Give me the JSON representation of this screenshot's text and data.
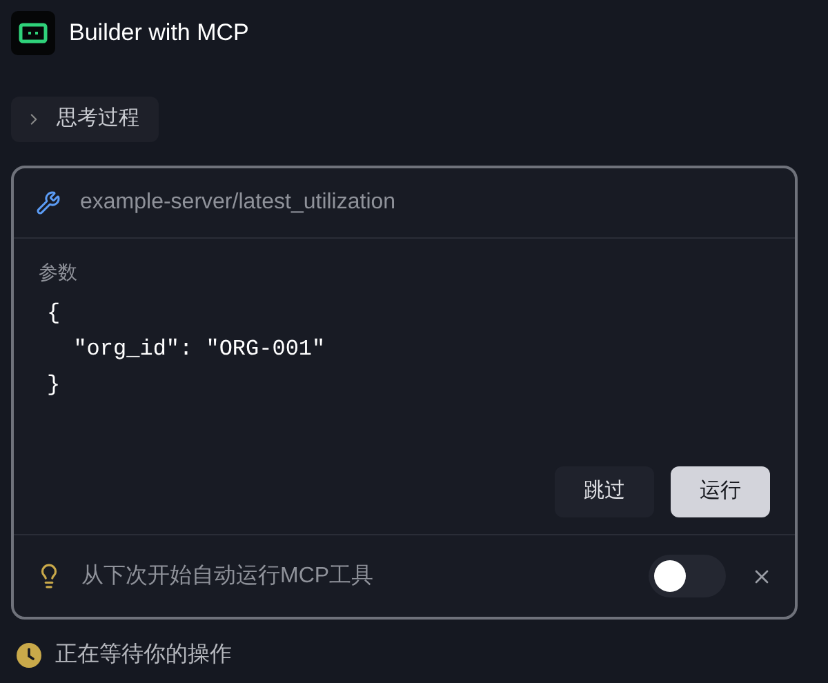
{
  "header": {
    "title": "Builder with MCP"
  },
  "thinking": {
    "label": "思考过程",
    "expanded": false
  },
  "tool_call": {
    "name": "example-server/latest_utilization",
    "params_label": "参数",
    "code_lines": [
      "{",
      "  \"org_id\": \"ORG-001\"",
      "}"
    ],
    "buttons": [
      {
        "label": "跳过",
        "kind": "secondary"
      },
      {
        "label": "运行",
        "kind": "primary"
      }
    ],
    "auto_run": {
      "label": "从下次开始自动运行MCP工具",
      "on": false
    }
  },
  "status": {
    "text": "正在等待你的操作"
  }
}
